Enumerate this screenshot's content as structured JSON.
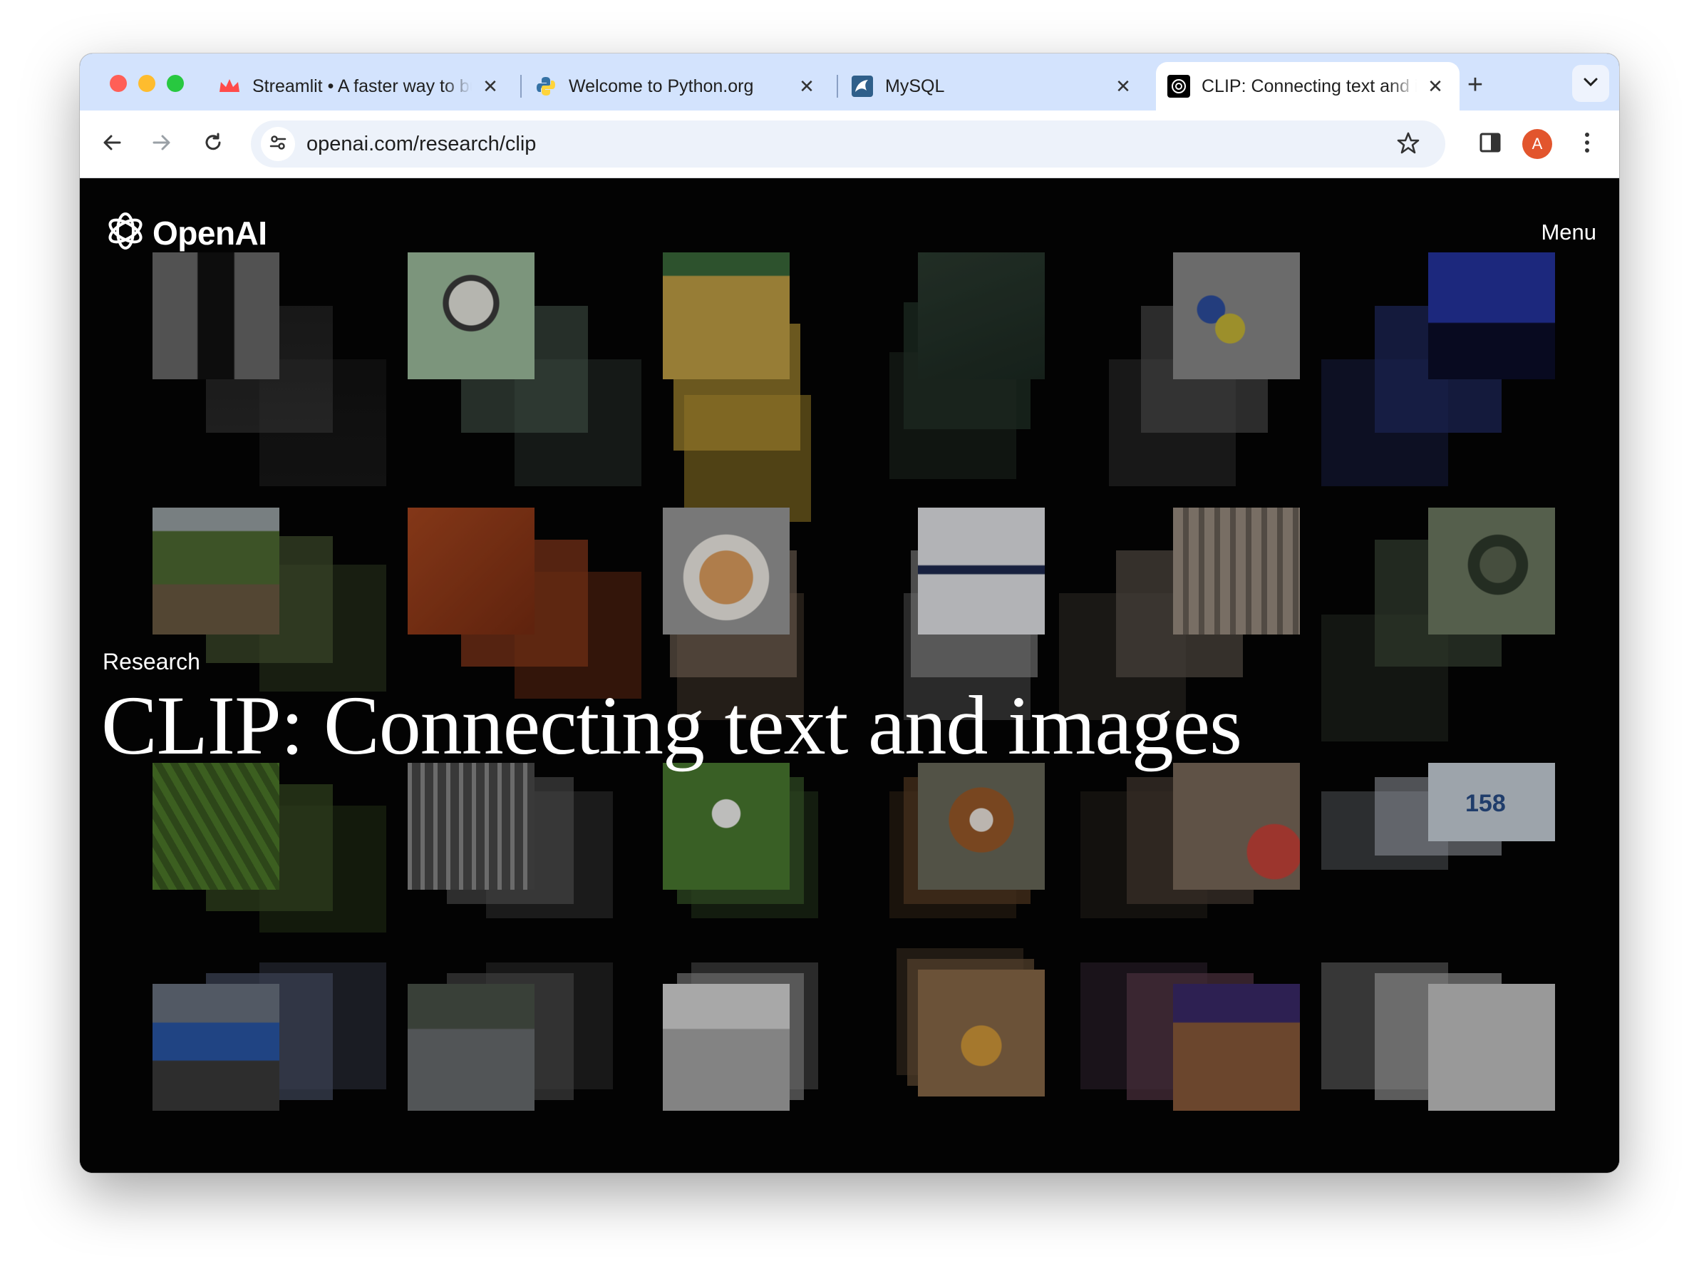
{
  "browser": {
    "tabs": [
      {
        "title": "Streamlit • A faster way to build and share data apps",
        "favicon": "streamlit-crown-icon",
        "active": false
      },
      {
        "title": "Welcome to Python.org",
        "favicon": "python-icon",
        "active": false
      },
      {
        "title": "MySQL",
        "favicon": "mysql-dolphin-icon",
        "active": false
      },
      {
        "title": "CLIP: Connecting text and images",
        "favicon": "openai-icon",
        "active": true
      }
    ],
    "close_glyph": "✕",
    "new_tab_glyph": "+",
    "url": "openai.com/research/clip",
    "profile_initial": "A",
    "colors": {
      "tab_strip": "#d3e3fd",
      "profile": "#e2552d"
    }
  },
  "page": {
    "logo_text": "OpenAI",
    "menu_label": "Menu",
    "eyebrow": "Research",
    "title": "CLIP: Connecting text and images",
    "tile_labels": {
      "counter": "158"
    },
    "background": "#050505"
  }
}
